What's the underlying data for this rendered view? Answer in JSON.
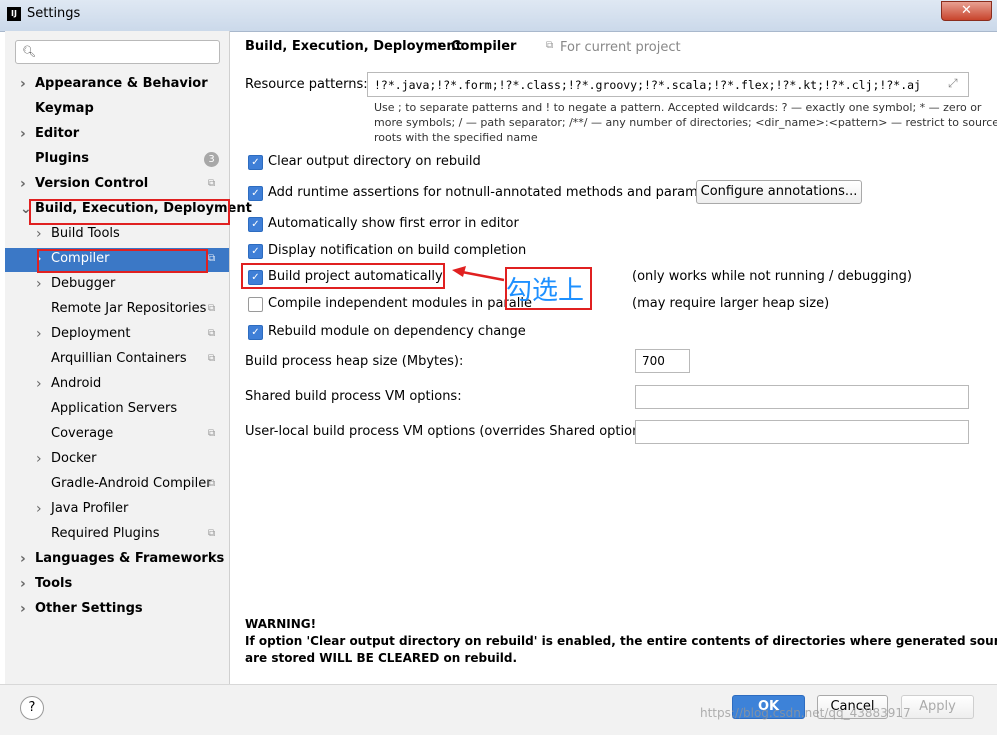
{
  "window": {
    "title": "Settings",
    "close_label": "✕"
  },
  "sidebar": {
    "search_placeholder": "",
    "items": [
      {
        "label": "Appearance & Behavior",
        "level": 0,
        "arrow": true
      },
      {
        "label": "Keymap",
        "level": 0,
        "arrow": false
      },
      {
        "label": "Editor",
        "level": 0,
        "arrow": true
      },
      {
        "label": "Plugins",
        "level": 0,
        "arrow": false,
        "badge": "3"
      },
      {
        "label": "Version Control",
        "level": 0,
        "arrow": true,
        "copy": true
      },
      {
        "label": "Build, Execution, Deployment",
        "level": 0,
        "arrow": true,
        "expanded": true
      },
      {
        "label": "Build Tools",
        "level": 1,
        "arrow": true
      },
      {
        "label": "Compiler",
        "level": 1,
        "arrow": true,
        "selected": true,
        "copy": true
      },
      {
        "label": "Debugger",
        "level": 1,
        "arrow": true
      },
      {
        "label": "Remote Jar Repositories",
        "level": 1,
        "arrow": false,
        "copy": true
      },
      {
        "label": "Deployment",
        "level": 1,
        "arrow": true,
        "copy": true
      },
      {
        "label": "Arquillian Containers",
        "level": 1,
        "arrow": false,
        "copy": true
      },
      {
        "label": "Android",
        "level": 1,
        "arrow": true
      },
      {
        "label": "Application Servers",
        "level": 1,
        "arrow": false
      },
      {
        "label": "Coverage",
        "level": 1,
        "arrow": false,
        "copy": true
      },
      {
        "label": "Docker",
        "level": 1,
        "arrow": true
      },
      {
        "label": "Gradle-Android Compiler",
        "level": 1,
        "arrow": false,
        "copy": true
      },
      {
        "label": "Java Profiler",
        "level": 1,
        "arrow": true
      },
      {
        "label": "Required Plugins",
        "level": 1,
        "arrow": false,
        "copy": true
      },
      {
        "label": "Languages & Frameworks",
        "level": 0,
        "arrow": true
      },
      {
        "label": "Tools",
        "level": 0,
        "arrow": true
      },
      {
        "label": "Other Settings",
        "level": 0,
        "arrow": true
      }
    ]
  },
  "breadcrumb": {
    "parent": "Build, Execution, Deployment",
    "separator": "›",
    "current": "Compiler",
    "scope": "For current project"
  },
  "resource_patterns": {
    "label": "Resource patterns:",
    "value": "!?*.java;!?*.form;!?*.class;!?*.groovy;!?*.scala;!?*.flex;!?*.kt;!?*.clj;!?*.aj",
    "help_line1": "Use ; to separate patterns and ! to negate a pattern. Accepted wildcards: ? — exactly one symbol; * — zero or",
    "help_line2": "more symbols; / — path separator; /**/ — any number of directories; <dir_name>:<pattern> — restrict to source",
    "help_line3": "roots with the specified name"
  },
  "options": [
    {
      "label": "Clear output directory on rebuild",
      "checked": true
    },
    {
      "label": "Add runtime assertions for notnull-annotated methods and parameters",
      "checked": true
    },
    {
      "label": "Automatically show first error in editor",
      "checked": true
    },
    {
      "label": "Display notification on build completion",
      "checked": true
    },
    {
      "label": "Build project automatically",
      "checked": true,
      "note": "(only works while not running / debugging)"
    },
    {
      "label": "Compile independent modules in paralle",
      "checked": false,
      "note": "(may require larger heap size)"
    },
    {
      "label": "Rebuild module on dependency change",
      "checked": true
    }
  ],
  "configure_annotations_label": "Configure annotations...",
  "annotation_text": "勾选上",
  "heap": {
    "label": "Build process heap size (Mbytes):",
    "value": "700"
  },
  "shared_vm": {
    "label": "Shared build process VM options:",
    "value": ""
  },
  "user_vm": {
    "label": "User-local build process VM options (overrides Shared options):",
    "value": ""
  },
  "warning": {
    "title": "WARNING!",
    "line1": "If option 'Clear output directory on rebuild' is enabled, the entire contents of directories where generated sources",
    "line2": "are stored WILL BE CLEARED on rebuild."
  },
  "footer": {
    "help": "?",
    "ok": "OK",
    "cancel": "Cancel",
    "apply": "Apply",
    "watermark": "https://blog.csdn.net/qq_43883917"
  },
  "colors": {
    "accent": "#3b78c6",
    "annotation": "#e02020",
    "annotation_text": "#1e90ff"
  }
}
